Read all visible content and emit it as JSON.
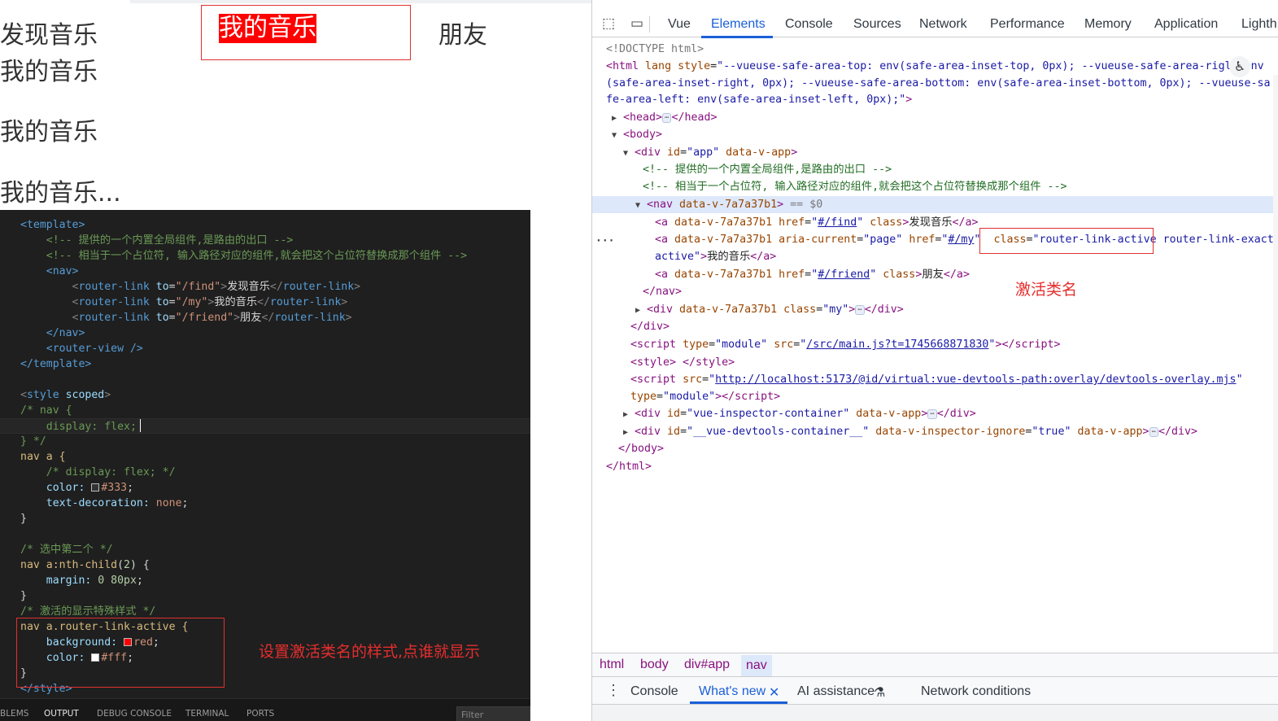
{
  "preview": {
    "nav": [
      "发现音乐",
      "我的音乐",
      "朋友"
    ],
    "views": [
      "我的音乐",
      "我的音乐",
      "我的音乐..."
    ]
  },
  "editor": {
    "template_open": "<template>",
    "cmt1": "<!-- 提供的一个内置全局组件,是路由的出口 -->",
    "cmt2": "<!-- 相当于一个占位符, 输入路径对应的组件,就会把这个占位符替换成那个组件 -->",
    "nav_open": "<nav>",
    "link1_to": "\"/find\"",
    "link1_text": "发现音乐",
    "link2_to": "\"/my\"",
    "link2_text": "我的音乐",
    "link3_to": "\"/friend\"",
    "link3_text": "朋友",
    "nav_close": "</nav>",
    "router_view": "<router-view />",
    "template_close": "</template>",
    "style_open_tag": "style",
    "style_open_attr": "scoped",
    "c_nav_open": "/* nav {",
    "c_display": "display: flex;",
    "c_close": "} */",
    "sel_nav_a": "nav a {",
    "c_display2": "/* display: flex; */",
    "prop_color": "color:",
    "val_333": "#333",
    "prop_td": "text-decoration:",
    "val_none": "none",
    "brace_close": "}",
    "cmt_second": "/* 选中第二个 */",
    "sel_nth": "nav a:nth-child",
    "nth_arg": "2",
    "prop_margin": "margin:",
    "val_margin": "0 80px",
    "cmt_active": "/* 激活的显示特殊样式 */",
    "sel_active": "nav a.router-link-active {",
    "prop_bg": "background:",
    "val_red": "red",
    "val_fff": "#fff",
    "style_close": "</style>",
    "annotation": "设置激活类名的样式,点谁就显示",
    "panel_tabs": [
      "BLEMS",
      "OUTPUT",
      "DEBUG CONSOLE",
      "TERMINAL",
      "PORTS"
    ],
    "filter_placeholder": "Filter"
  },
  "devtools": {
    "tabs": [
      "Vue",
      "Elements",
      "Console",
      "Sources",
      "Network",
      "Performance",
      "Memory",
      "Application",
      "Lighth"
    ],
    "active_tab": "Elements",
    "doctype": "<!DOCTYPE html>",
    "html_style_1": "--vueuse-safe-area-top: env(safe-area-inset-top, 0px); --vueuse-safe-area-rigl",
    "html_env": "env",
    "html_style_2": "(safe-area-inset-right, 0px); --vueuse-safe-area-bottom: env(safe-area-inset-bottom, 0px); --vueuse-sa",
    "html_style_3": "fe-area-left: env(safe-area-inset-left, 0px);",
    "cmt1": "<!-- 提供的一个内置全局组件,是路由的出口 -->",
    "cmt2": "<!-- 相当于一个占位符, 输入路径对应的组件,就会把这个占位符替换成那个组件 -->",
    "scope_attr": "data-v-7a7a37b1",
    "sel_marker": "== $0",
    "a1_href": "#/find",
    "a1_text": "发现音乐",
    "a2_aria": "page",
    "a2_href": "#/my",
    "a2_class_1": "router-link-active",
    "a2_class_2": "router-link-exact-",
    "a2_class_3": "active",
    "a2_text": "我的音乐",
    "a3_href": "#/friend",
    "a3_text": "朋友",
    "div_class": "my",
    "script_src": "/src/main.js?t=1745668871830",
    "script2_src": "http://localhost:5173/@id/virtual:vue-devtools-path:overlay/devtools-overlay.mjs",
    "type_module": "module",
    "inspector_id": "vue-inspector-container",
    "devtools_id": "__vue-devtools-container__",
    "ignore_val": "true",
    "annotation": "激活类名",
    "breadcrumbs": [
      "html",
      "body",
      "div#app",
      "nav"
    ],
    "drawer_tabs": [
      "Console",
      "What's new",
      "AI assistance",
      "Network conditions"
    ]
  },
  "colors": {
    "active_bg": "#ff0000",
    "annotation": "#e52d2d",
    "devtools_accent": "#1a5fd8"
  }
}
